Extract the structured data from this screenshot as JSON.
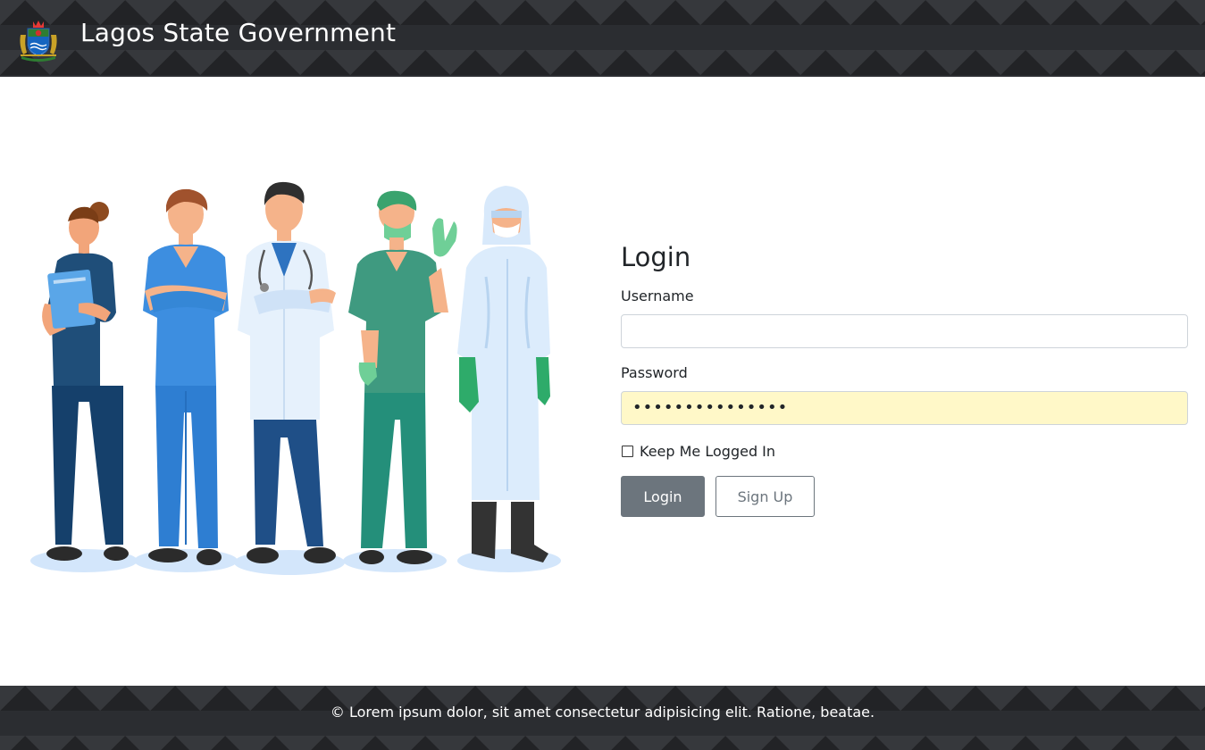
{
  "header": {
    "title": "Lagos State Government",
    "logo_icon": "lagos-state-crest-icon"
  },
  "illustration": {
    "icon": "healthcare-workers-illustration"
  },
  "login": {
    "heading": "Login",
    "username_label": "Username",
    "username_value": "",
    "password_label": "Password",
    "password_value": "•••••••••••••••",
    "remember_label": "Keep Me Logged In",
    "remember_checked": false,
    "login_button": "Login",
    "signup_button": "Sign Up"
  },
  "footer": {
    "text": "© Lorem ipsum dolor, sit amet consectetur adipisicing elit. Ratione, beatae."
  },
  "colors": {
    "header_bg": "#2b2d31",
    "button_secondary": "#6c757d",
    "autofill_bg": "#fff8c8"
  }
}
